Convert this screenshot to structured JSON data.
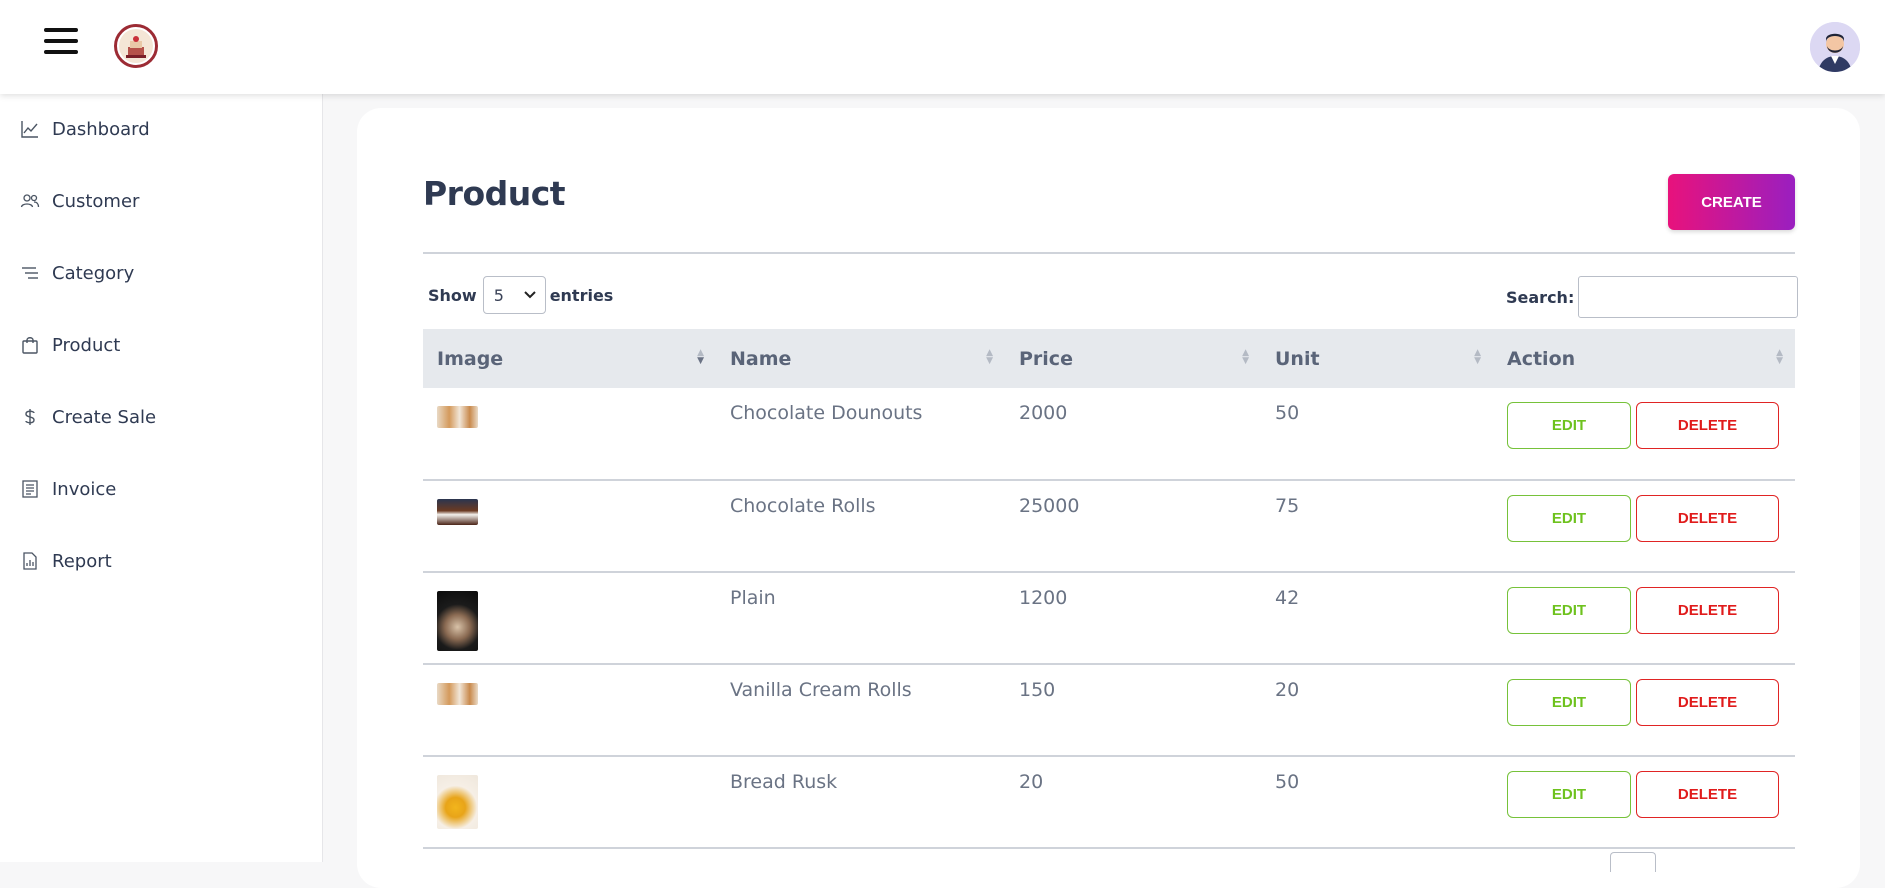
{
  "sidebar": {
    "items": [
      {
        "label": "Dashboard",
        "icon": "line-chart-icon"
      },
      {
        "label": "Customer",
        "icon": "users-icon"
      },
      {
        "label": "Category",
        "icon": "list-icon"
      },
      {
        "label": "Product",
        "icon": "shopping-bag-icon"
      },
      {
        "label": "Create Sale",
        "icon": "dollar-icon"
      },
      {
        "label": "Invoice",
        "icon": "invoice-icon"
      },
      {
        "label": "Report",
        "icon": "report-icon"
      }
    ]
  },
  "main": {
    "title": "Product",
    "create_label": "CREATE",
    "show_label": "Show",
    "entries_value": "5",
    "entries_label": "entries",
    "search_label": "Search:",
    "search_value": ""
  },
  "table": {
    "columns": [
      "Image",
      "Name",
      "Price",
      "Unit",
      "Action"
    ],
    "rows": [
      {
        "name": "Chocolate Dounouts",
        "price": "2000",
        "unit": "50"
      },
      {
        "name": "Chocolate Rolls",
        "price": "25000",
        "unit": "75"
      },
      {
        "name": "Plain",
        "price": "1200",
        "unit": "42"
      },
      {
        "name": "Vanilla Cream Rolls",
        "price": "150",
        "unit": "20"
      },
      {
        "name": "Bread Rusk",
        "price": "20",
        "unit": "50"
      }
    ],
    "edit_label": "EDIT",
    "delete_label": "DELETE"
  },
  "colors": {
    "accent_start": "#e8127c",
    "accent_end": "#9a1fc0",
    "edit": "#6ec21e",
    "delete": "#e01b1b"
  }
}
